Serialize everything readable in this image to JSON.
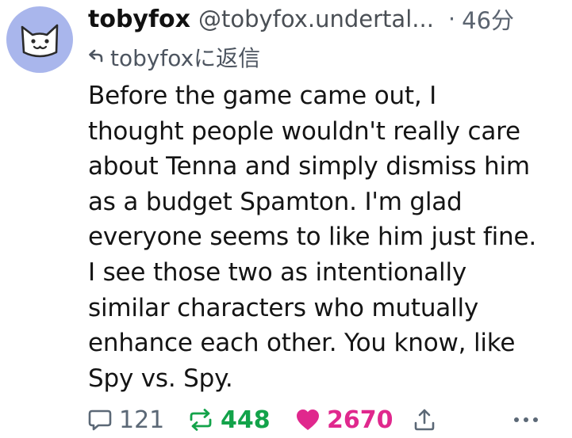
{
  "post": {
    "display_name": "tobyfox",
    "handle": "@tobyfox.undertal...",
    "separator": "·",
    "time": "46分",
    "reply_to": "tobyfoxに返信",
    "lines": [
      "Before the game came out, I",
      "thought people wouldn't really care",
      "about Tenna and simply dismiss him",
      "as a budget Spamton. I'm glad",
      "everyone seems to like him just fine.",
      "I see those two as intentionally",
      "similar characters who mutually",
      "enhance each other. You know, like",
      "Spy vs. Spy."
    ],
    "counts": {
      "replies": "121",
      "reposts": "448",
      "likes": "2670"
    }
  },
  "colors": {
    "avatar_bg": "#a9b6ec",
    "repost_active": "#13a34a",
    "like_active": "#e0288d",
    "muted": "#5b6876"
  },
  "icons": {
    "avatar": "cat-face-avatar",
    "reply_indicator": "reply-arrow-icon",
    "reply": "speech-bubble-icon",
    "repost": "repost-arrows-icon",
    "like": "heart-icon",
    "share": "share-upload-icon",
    "more": "more-dots-icon"
  }
}
